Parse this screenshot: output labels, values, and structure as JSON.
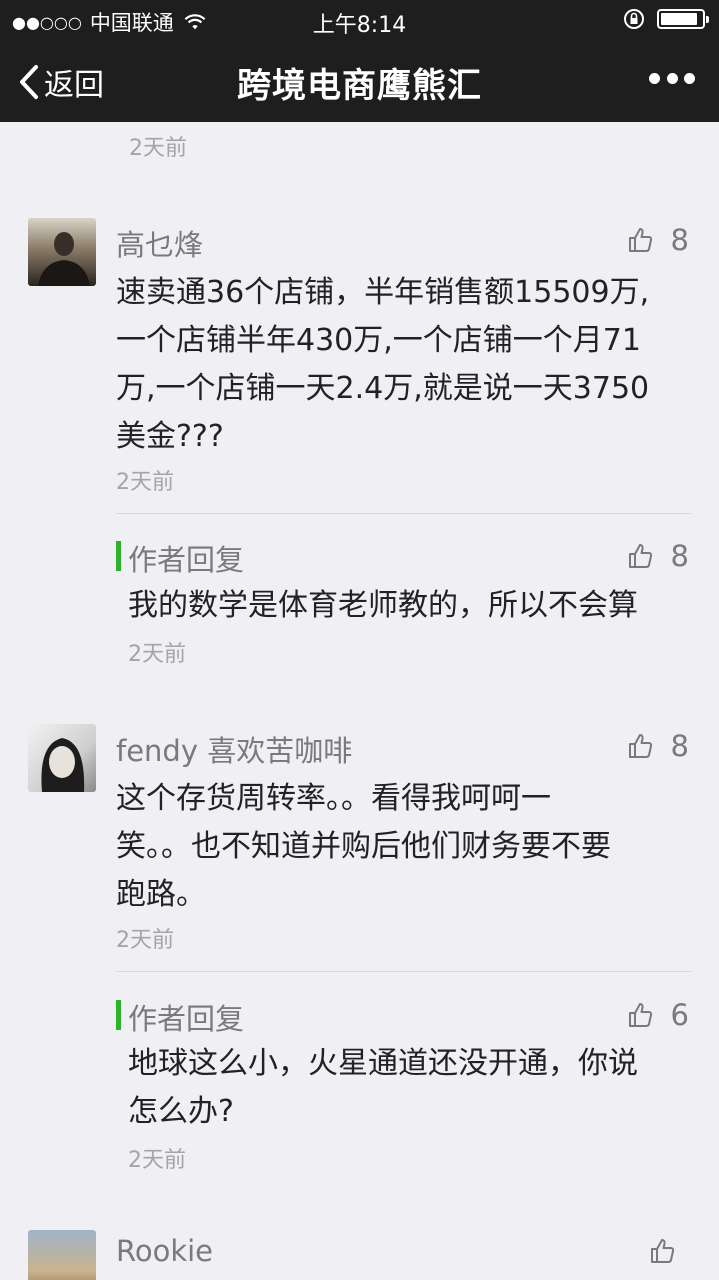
{
  "status": {
    "carrier": "中国联通",
    "signal_dots": "●●○○○",
    "time": "上午8:14"
  },
  "nav": {
    "back_label": "返回",
    "title": "跨境电商鹰熊汇"
  },
  "comments": [
    {
      "time": "2天前"
    },
    {
      "name": "高乜烽",
      "likes": "8",
      "lines": [
        "速卖通36个店铺，半年销售额15509万,",
        "一个店铺半年430万,一个店铺一个月71",
        "万,一个店铺一天2.4万,就是说一天3750",
        "美金???"
      ],
      "time": "2天前",
      "reply": {
        "label": "作者回复",
        "likes": "8",
        "lines": [
          "我的数学是体育老师教的，所以不会算"
        ],
        "time": "2天前"
      }
    },
    {
      "name": "fendy 喜欢苦咖啡",
      "likes": "8",
      "lines": [
        "这个存货周转率。。看得我呵呵一",
        "笑。。也不知道并购后他们财务要不要",
        "跑路。"
      ],
      "time": "2天前",
      "reply": {
        "label": "作者回复",
        "likes": "6",
        "lines": [
          "地球这么小，火星通道还没开通，你说",
          "怎么办?"
        ],
        "time": "2天前"
      }
    },
    {
      "name": "Rookie"
    }
  ],
  "colors": {
    "bar_bg": "#1e1e1e",
    "page_bg": "#efeff4",
    "reply_accent": "#2bb32b"
  }
}
